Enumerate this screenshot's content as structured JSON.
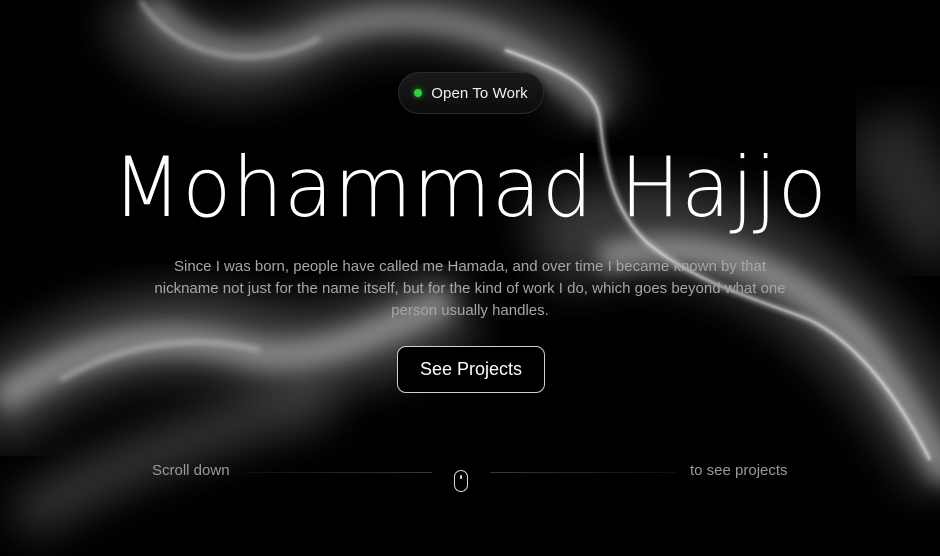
{
  "badge": {
    "label": "Open To Work",
    "status_color": "#2bd63a",
    "icon": "status-dot-icon"
  },
  "hero": {
    "title": "Mohammad Hajjo",
    "description": "Since I was born, people have called me Hamada, and over time I became known by that nickname not just for the name itself, but for the kind of work I do, which goes beyond what one person usually handles.",
    "cta_label": "See Projects"
  },
  "scroll_hint": {
    "left_text": "Scroll down",
    "right_text": "to see projects",
    "icon": "mouse-icon"
  },
  "colors": {
    "background": "#000000",
    "text_primary": "#ffffff",
    "text_secondary": "#a6a6a6",
    "accent_green": "#2bd63a"
  }
}
